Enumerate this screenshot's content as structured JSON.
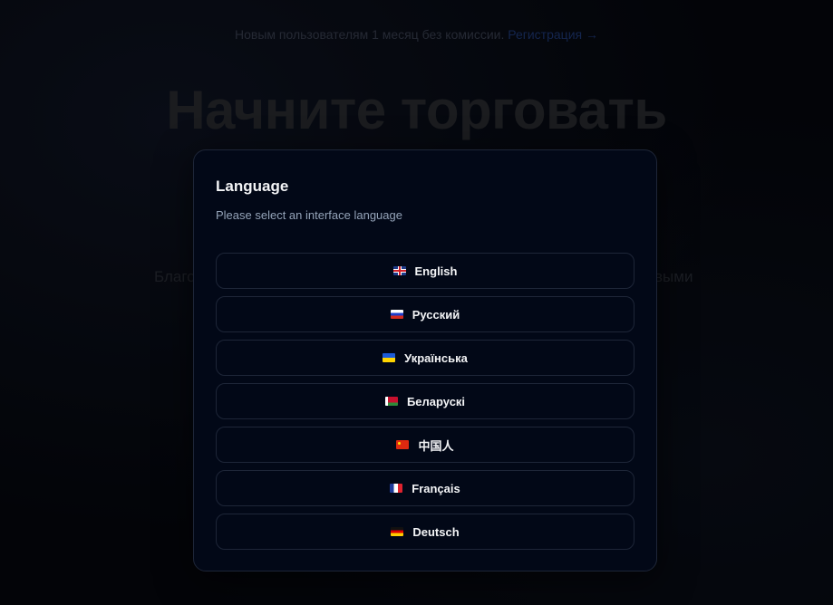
{
  "background": {
    "promo_text": "Новым пользователям 1 месяц без комиссии.",
    "promo_link": "Регистрация →",
    "hero_title_line1": "Начните торговать",
    "hero_title_line2": "",
    "hero_sub_left": "Благо",
    "hero_sub_right": "выми"
  },
  "modal": {
    "title": "Language",
    "description": "Please select an interface language",
    "languages": [
      {
        "label": "English",
        "flag": "gb-flag-icon"
      },
      {
        "label": "Русский",
        "flag": "ru-flag-icon"
      },
      {
        "label": "Українська",
        "flag": "ua-flag-icon"
      },
      {
        "label": "Беларускі",
        "flag": "by-flag-icon"
      },
      {
        "label": "中国人",
        "flag": "cn-flag-icon"
      },
      {
        "label": "Français",
        "flag": "fr-flag-icon"
      },
      {
        "label": "Deutsch",
        "flag": "de-flag-icon"
      }
    ]
  },
  "colors": {
    "background": "#05070d",
    "modal_bg": "#020817",
    "border": "#1e2638",
    "text_primary": "#f3f4f6",
    "text_muted": "#94a3b8"
  }
}
